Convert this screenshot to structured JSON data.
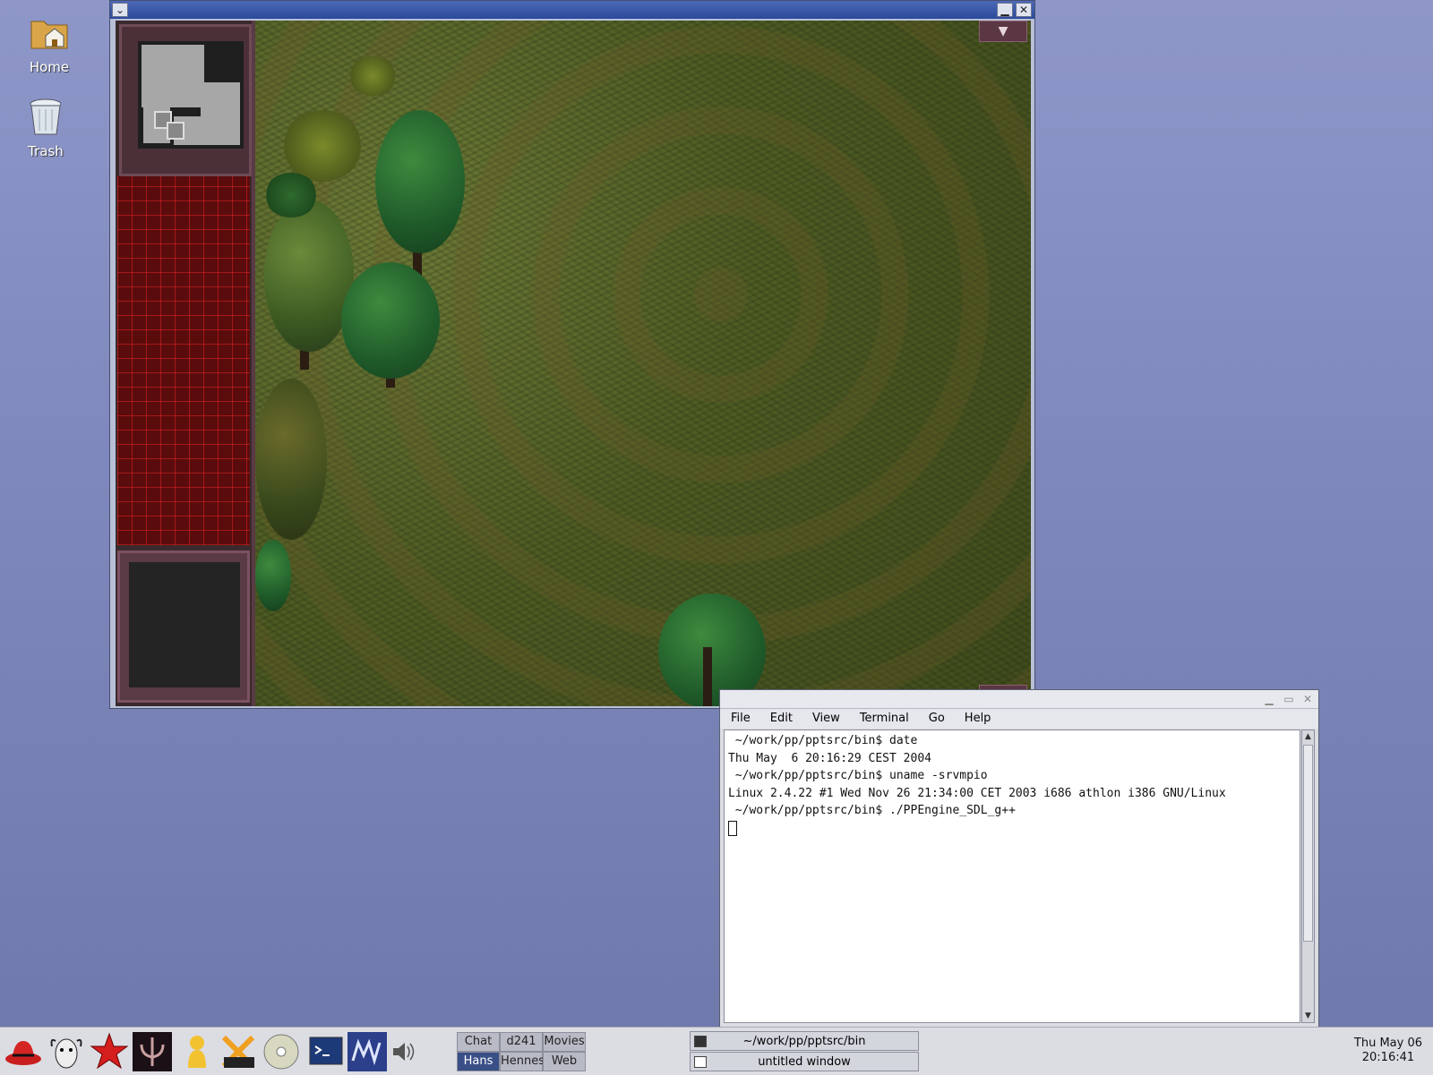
{
  "desktop": {
    "icons": [
      {
        "label": "Home",
        "icon": "home-folder-icon"
      },
      {
        "label": "Trash",
        "icon": "trash-can-icon"
      }
    ]
  },
  "game_window": {
    "title": "",
    "controls": {
      "menu": "⌄",
      "minimize": "▁",
      "close": "✕"
    },
    "scroll_up_arrow": "▼",
    "scroll_down_arrow": "▲"
  },
  "terminal": {
    "title_controls": {
      "minimize": "▁",
      "maximize": "▭",
      "close": "✕"
    },
    "menu": [
      "File",
      "Edit",
      "View",
      "Terminal",
      "Go",
      "Help"
    ],
    "lines": [
      " ~/work/pp/pptsrc/bin$ date",
      "Thu May  6 20:16:29 CEST 2004",
      " ~/work/pp/pptsrc/bin$ uname -srvmpio",
      "Linux 2.4.22 #1 Wed Nov 26 21:34:00 CET 2003 i686 athlon i386 GNU/Linux",
      " ~/work/pp/pptsrc/bin$ ./PPEngine_SDL_g++"
    ]
  },
  "panel": {
    "launchers": [
      "redhat-menu-icon",
      "gnu-icon",
      "star-game-icon",
      "quake-icon",
      "user-icon",
      "xchat-icon",
      "cd-player-icon",
      "terminal-icon",
      "mms-icon",
      "volume-icon"
    ],
    "pager": [
      "Chat",
      "d241",
      "Movies",
      "Hans",
      "Hennes",
      "Web"
    ],
    "pager_active": "Hans",
    "tasks": [
      "~/work/pp/pptsrc/bin",
      "untitled window"
    ],
    "clock_date": "Thu May 06",
    "clock_time": "20:16:41"
  }
}
